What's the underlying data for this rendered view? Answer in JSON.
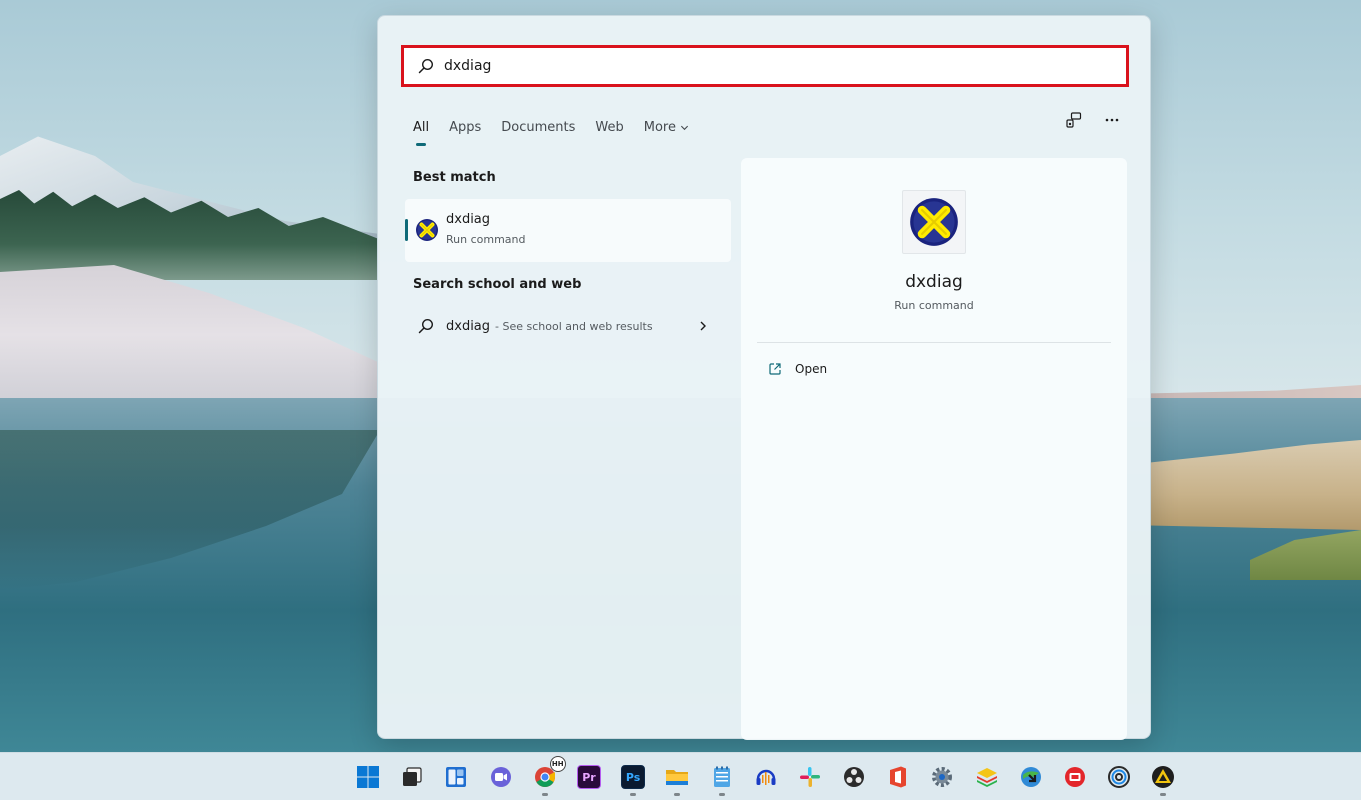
{
  "search": {
    "query": "dxdiag",
    "placeholder": ""
  },
  "tabs": [
    {
      "label": "All",
      "active": true
    },
    {
      "label": "Apps"
    },
    {
      "label": "Documents"
    },
    {
      "label": "Web"
    },
    {
      "label": "More"
    }
  ],
  "top_actions": {
    "share_icon": "connected-devices-icon",
    "more_icon": "ellipsis-icon"
  },
  "best_match": {
    "title": "Best match",
    "item": {
      "name": "dxdiag",
      "type": "Run command",
      "icon": "directx-icon"
    }
  },
  "web_search": {
    "title": "Search school and web",
    "query": "dxdiag",
    "hint": "- See school and web results"
  },
  "preview": {
    "name": "dxdiag",
    "type": "Run command",
    "action_label": "Open"
  },
  "colors": {
    "accent": "#0f6a78",
    "highlight_border": "#d9121c"
  },
  "taskbar": {
    "apps": [
      {
        "name": "start-icon"
      },
      {
        "name": "task-view-icon"
      },
      {
        "name": "widgets-icon"
      },
      {
        "name": "teams-chat-icon"
      },
      {
        "name": "chrome-icon",
        "badge": "HH"
      },
      {
        "name": "premiere-pro-icon",
        "glyph": "Pr"
      },
      {
        "name": "photoshop-icon",
        "glyph": "Ps"
      },
      {
        "name": "file-explorer-icon"
      },
      {
        "name": "notepad-icon"
      },
      {
        "name": "audacity-icon"
      },
      {
        "name": "slack-icon"
      },
      {
        "name": "obs-icon"
      },
      {
        "name": "office-icon"
      },
      {
        "name": "settings-icon"
      },
      {
        "name": "bluestacks-icon"
      },
      {
        "name": "internet-download-manager-icon"
      },
      {
        "name": "screen-recorder-icon"
      },
      {
        "name": "spiral-app-icon"
      },
      {
        "name": "triangle-app-icon"
      }
    ]
  }
}
